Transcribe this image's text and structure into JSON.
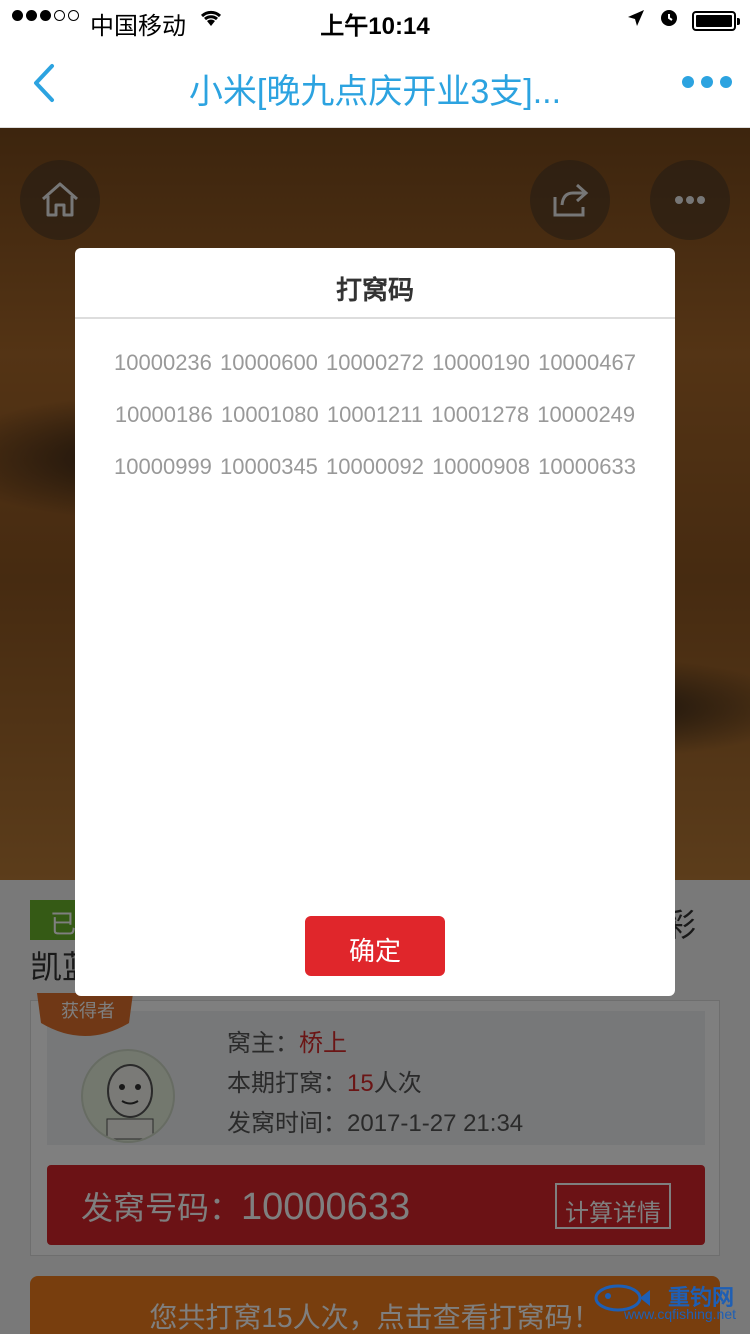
{
  "status_bar": {
    "carrier": "中国移动",
    "time": "上午10:14"
  },
  "nav": {
    "title": "小米[晚九点庆开业3支]..."
  },
  "listing": {
    "status_tag": "已",
    "title_right": "彩",
    "title_left": "凯蓝"
  },
  "winner": {
    "badge": "获得者",
    "owner_label": "窝主：",
    "owner_value": "桥上",
    "count_label": "本期打窝：",
    "count_value": "15",
    "count_unit": "人次",
    "time_label": "发窝时间：",
    "time_value": "2017-1-27 21:34",
    "code_label": "发窝号码：",
    "code_value": "10000633",
    "detail_button": "计算详情"
  },
  "summary_button": "您共打窝15人次，点击查看打窝码！",
  "modal": {
    "title": "打窝码",
    "codes": [
      "10000236",
      "10000600",
      "10000272",
      "10000190",
      "10000467",
      "10000186",
      "10001080",
      "10001211",
      "10001278",
      "10000249",
      "10000999",
      "10000345",
      "10000092",
      "10000908",
      "10000633"
    ],
    "ok_button": "确定"
  },
  "watermark": {
    "name": "重钓网",
    "url": "www.cqfishing.net"
  },
  "colors": {
    "accent_blue": "#2ca3e0",
    "primary_red": "#e0262b",
    "orange": "#f07d1c",
    "tag_green": "#6bb52a"
  },
  "icons": [
    "back-icon",
    "more-icon",
    "home-icon",
    "share-icon",
    "ellipsis-icon",
    "wifi-icon",
    "location-icon",
    "alarm-icon",
    "battery-icon"
  ]
}
